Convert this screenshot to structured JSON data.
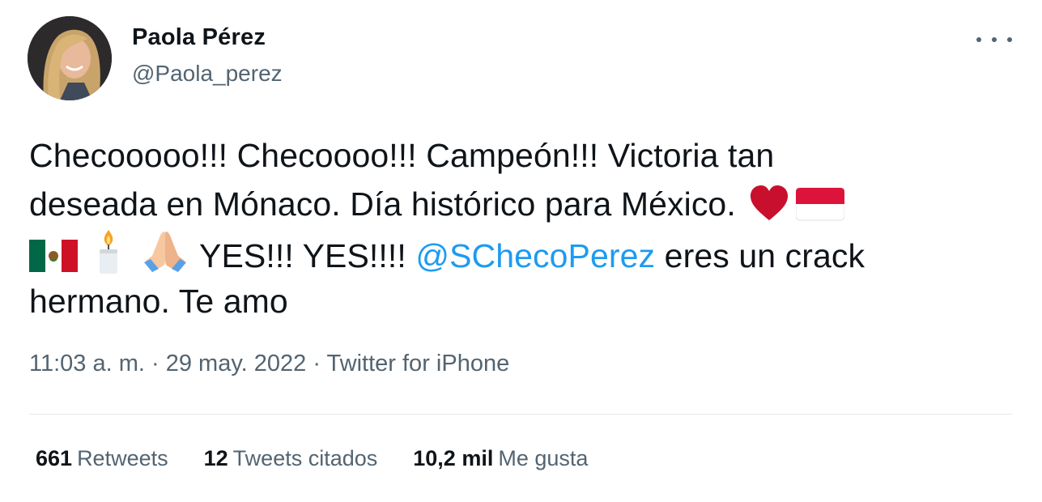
{
  "author": {
    "name": "Paola Pérez",
    "handle": "@Paola_perez"
  },
  "tweet": {
    "line1": "Checooooo!!! Checoooo!!! Campeón!!! Victoria tan",
    "line2": "deseada en Mónaco. Día histórico para México.",
    "line3_text": "YES!!! YES!!!!",
    "mention": "@SChecoPerez",
    "line3_after": "eres un crack",
    "line4": "hermano. Te amo",
    "emojis": [
      "heart-emoji",
      "monaco-flag-emoji",
      "mexico-flag-emoji",
      "candle-emoji",
      "folded-hands-emoji"
    ]
  },
  "meta": {
    "time": "11:03 a. m.",
    "sep1": " · ",
    "date": "29 may. 2022",
    "sep2": " · ",
    "source": "Twitter for iPhone"
  },
  "stats": {
    "retweets_count": "661",
    "retweets_label": "Retweets",
    "quotes_count": "12",
    "quotes_label": "Tweets citados",
    "likes_count": "10,2 mil",
    "likes_label": "Me gusta"
  },
  "colors": {
    "text": "#0f1419",
    "secondary": "#536471",
    "link": "#1d9bf0",
    "divider": "#e6ecf0"
  }
}
